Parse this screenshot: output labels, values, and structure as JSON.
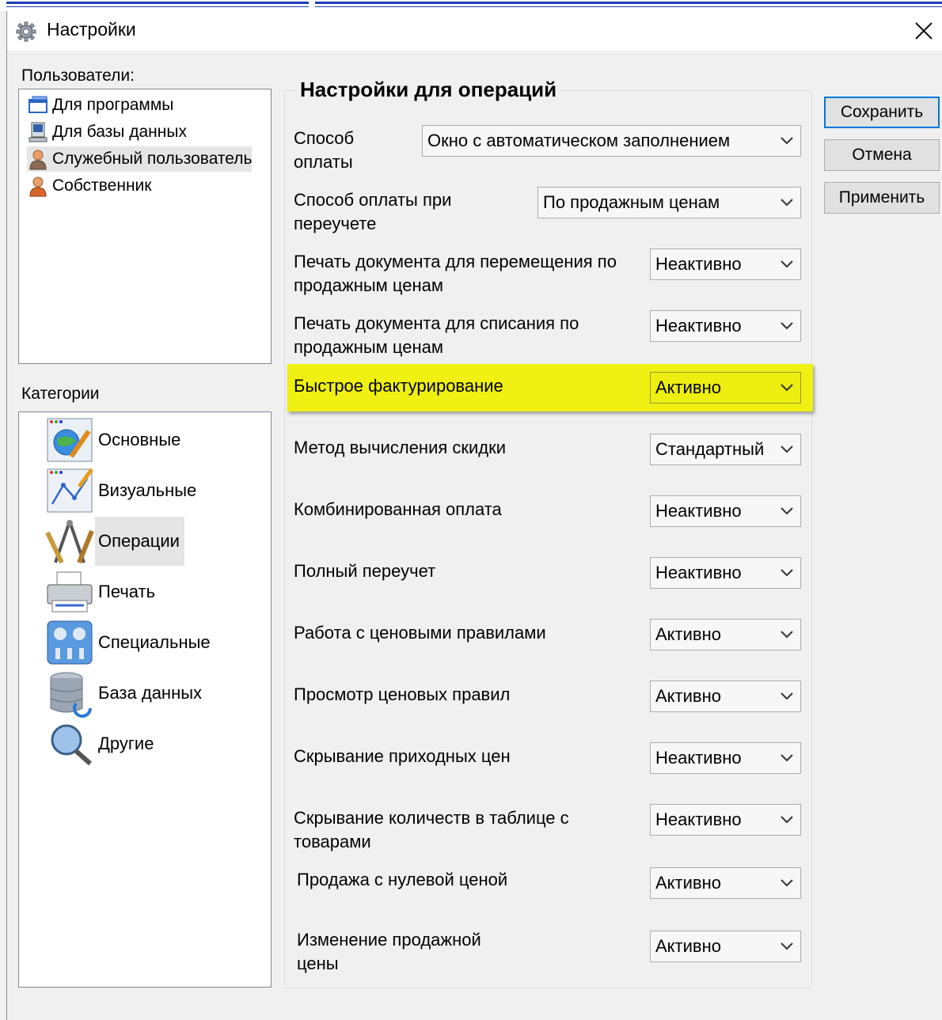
{
  "window": {
    "title": "Настройки",
    "icon": "gear-icon"
  },
  "users": {
    "label": "Пользователи:",
    "items": [
      {
        "label": "Для программы",
        "icon": "windows-app-icon"
      },
      {
        "label": "Для базы данных",
        "icon": "computer-icon"
      },
      {
        "label": "Служебный пользователь",
        "icon": "user-icon",
        "selected": true
      },
      {
        "label": "Собственник",
        "icon": "user-icon"
      }
    ]
  },
  "categories": {
    "label": "Категории",
    "items": [
      {
        "label": "Основные",
        "icon": "globe-tools-icon"
      },
      {
        "label": "Визуальные",
        "icon": "graph-pen-icon"
      },
      {
        "label": "Операции",
        "icon": "drafting-tools-icon",
        "selected": true
      },
      {
        "label": "Печать",
        "icon": "printer-icon"
      },
      {
        "label": "Специальные",
        "icon": "special-panel-icon"
      },
      {
        "label": "База данных",
        "icon": "database-icon"
      },
      {
        "label": "Другие",
        "icon": "magnifier-icon"
      }
    ]
  },
  "operations": {
    "title": "Настройки для операций",
    "rows": [
      {
        "label": "Способ оплаты",
        "value": "Окно с автоматическом заполнением"
      },
      {
        "label": "Способ оплаты при переучете",
        "value": "По продажным ценам"
      },
      {
        "label": "Печать документа для перемещения по продажным ценам",
        "value": "Неактивно"
      },
      {
        "label": "Печать документа для списания по продажным ценам",
        "value": "Неактивно"
      },
      {
        "label": "Быстрое фактурирование",
        "value": "Активно",
        "highlighted": true
      },
      {
        "label": "Метод вычисления скидки",
        "value": "Стандартный"
      },
      {
        "label": "Комбинированная оплата",
        "value": "Неактивно"
      },
      {
        "label": "Полный переучет",
        "value": "Неактивно"
      },
      {
        "label": "Работа с ценовыми правилами",
        "value": "Активно"
      },
      {
        "label": "Просмотр ценовых правил",
        "value": "Активно"
      },
      {
        "label": "Скрывание приходных цен",
        "value": "Неактивно"
      },
      {
        "label": "Скрывание количеств в таблице с товарами",
        "value": "Неактивно"
      },
      {
        "label": "Продажа с нулевой ценой",
        "value": "Активно"
      },
      {
        "label": "Изменение продажной цены",
        "value": "Активно"
      }
    ]
  },
  "buttons": {
    "save": "Сохранить",
    "cancel": "Отмена",
    "apply": "Применить"
  },
  "colors": {
    "highlight": "#f0f012",
    "default_button_border": "#0078d7",
    "selection": "#e5e5e5"
  }
}
